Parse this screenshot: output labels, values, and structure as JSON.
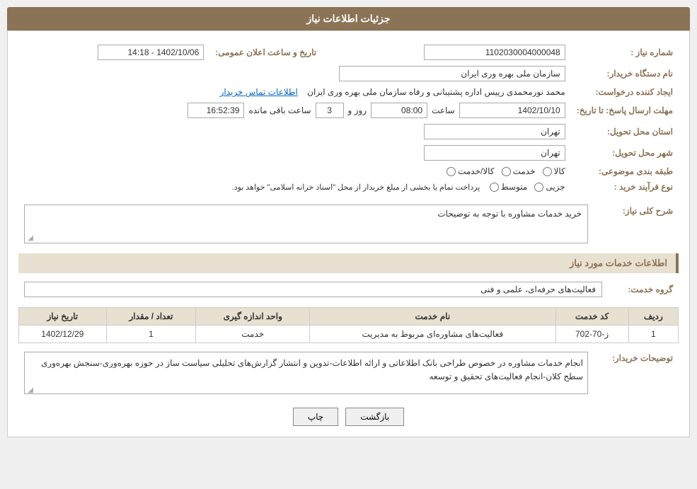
{
  "header": {
    "title": "جزئیات اطلاعات نیاز"
  },
  "fields": {
    "shomara_niaz_label": "شماره نیاز :",
    "shomara_niaz_value": "1102030004000048",
    "nam_dastgah_label": "نام دستگاه خریدار:",
    "nam_dastgah_value": "سازمان ملی بهره وری ایران",
    "ijad_konande_label": "ایجاد کننده درخواست:",
    "ijad_konande_value": "محمد نورمحمدی رییس اداره پشتیبانی و رفاه سازمان ملی بهره وری ایران",
    "ijad_konande_link": "اطلاعات تماس خریدار",
    "mohlat_label": "مهلت ارسال پاسخ: تا تاریخ:",
    "mohlat_date": "1402/10/10",
    "mohlat_saat_label": "ساعت",
    "mohlat_saat": "08:00",
    "mohlat_rooz_label": "روز و",
    "mohlat_rooz": "3",
    "mohlat_baqi_label": "ساعت باقی مانده",
    "mohlat_baqi": "16:52:39",
    "ostan_label": "استان محل تحویل:",
    "ostan_value": "تهران",
    "shahr_label": "شهر محل تحویل:",
    "shahr_value": "تهران",
    "tarikh_aalan_label": "تاریخ و ساعت اعلان عمومی:",
    "tarikh_aalan_value": "1402/10/06 - 14:18",
    "tabaqe_label": "طبقه بندی موضوعی:",
    "tabaqe_kala": "کالا",
    "tabaqe_khadamat": "خدمت",
    "tabaqe_kala_khadamat": "کالا/خدمت",
    "nooe_farayand_label": "نوع فرآیند خرید :",
    "nooe_jozii": "جزیی",
    "nooe_motosat": "متوسط",
    "nooe_note": "پرداخت تمام یا بخشی از مبلغ خریدار از محل \"اسناد خزانه اسلامی\" خواهد بود.",
    "sharh_label": "شرح کلی نیاز:",
    "sharh_value": "خرید خدمات مشاوره با توجه به توضیحات",
    "khadamat_section": "اطلاعات خدمات مورد نیاز",
    "grooh_label": "گروه خدمت:",
    "grooh_value": "فعالیت‌های حرفه‌ای، علمی و فنی",
    "table_headers": {
      "radif": "ردیف",
      "code_khadamat": "کد خدمت",
      "name_khadamat": "نام خدمت",
      "vahed": "واحد اندازه گیری",
      "tedad": "تعداد / مقدار",
      "tarikh": "تاریخ نیاز"
    },
    "table_rows": [
      {
        "radif": "1",
        "code": "ز-70-702",
        "name": "فعالیت‌های مشاوره‌ای مربوط به مدیریت",
        "vahed": "خدمت",
        "tedad": "1",
        "tarikh": "1402/12/29"
      }
    ],
    "tozihat_label": "توضیحات خریدار:",
    "tozihat_value": "انجام خدمات مشاوره در خصوص طراحی بانک اطلاعاتی و ارائه اطلاعات-تدوین و انتشار گزارش‌های تحلیلی سیاست ساز در حوزه بهره‌وری-سنجش بهره‌وری سطح کلان-انجام فعالیت‌های تحقیق و توسعه",
    "btn_chap": "چاپ",
    "btn_bazgasht": "بازگشت"
  }
}
